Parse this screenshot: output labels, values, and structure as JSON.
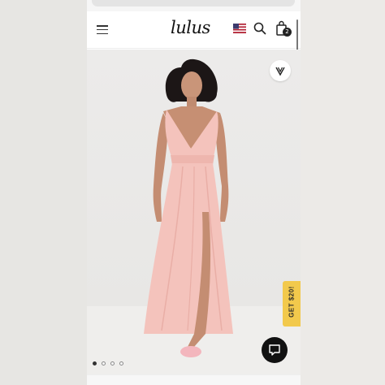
{
  "header": {
    "logo_text": "lulus",
    "bag_count": "2",
    "icons": [
      "menu-icon",
      "us-flag-icon",
      "search-icon",
      "shopping-bag-icon"
    ]
  },
  "product": {
    "wishlist_icon": "heart-v-icon",
    "dress_color": "#f4c3bc",
    "gallery": {
      "total_images": 4,
      "active_index": 0
    }
  },
  "promo": {
    "label": "GET $20!",
    "color": "#f2c94c"
  },
  "chat": {
    "icon": "chat-bubble-icon"
  }
}
